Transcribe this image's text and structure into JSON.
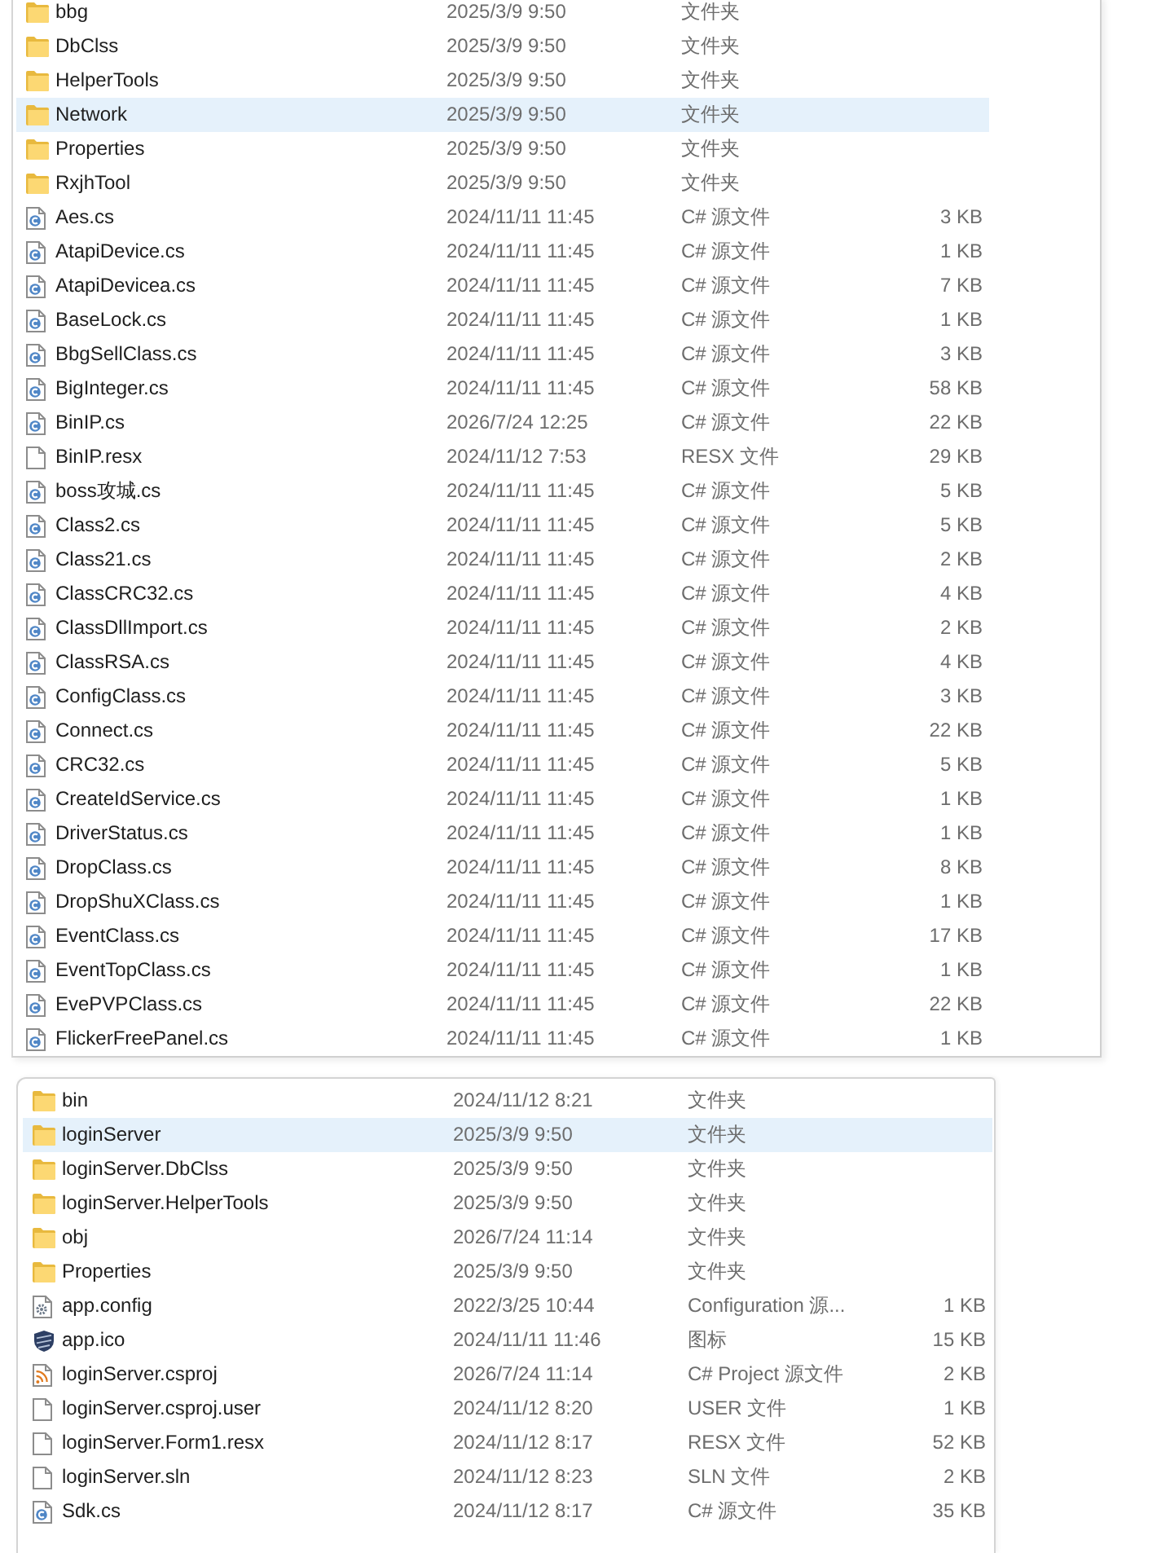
{
  "panels": [
    {
      "rows": [
        {
          "kind": "folder",
          "name": "bbg",
          "date": "2025/3/9 9:50",
          "type": "文件夹",
          "selected": false
        },
        {
          "kind": "folder",
          "name": "DbClss",
          "date": "2025/3/9 9:50",
          "type": "文件夹",
          "selected": false
        },
        {
          "kind": "folder",
          "name": "HelperTools",
          "date": "2025/3/9 9:50",
          "type": "文件夹",
          "selected": false
        },
        {
          "kind": "folder",
          "name": "Network",
          "date": "2025/3/9 9:50",
          "type": "文件夹",
          "selected": true
        },
        {
          "kind": "folder",
          "name": "Properties",
          "date": "2025/3/9 9:50",
          "type": "文件夹",
          "selected": false
        },
        {
          "kind": "folder",
          "name": "RxjhTool",
          "date": "2025/3/9 9:50",
          "type": "文件夹",
          "selected": false
        },
        {
          "kind": "source",
          "name": "Aes.cs",
          "date": "2024/11/11 11:45",
          "type": "C# 源文件",
          "size": "3 KB",
          "selected": false
        },
        {
          "kind": "source",
          "name": "AtapiDevice.cs",
          "date": "2024/11/11 11:45",
          "type": "C# 源文件",
          "size": "1 KB",
          "selected": false
        },
        {
          "kind": "source",
          "name": "AtapiDevicea.cs",
          "date": "2024/11/11 11:45",
          "type": "C# 源文件",
          "size": "7 KB",
          "selected": false
        },
        {
          "kind": "source",
          "name": "BaseLock.cs",
          "date": "2024/11/11 11:45",
          "type": "C# 源文件",
          "size": "1 KB",
          "selected": false
        },
        {
          "kind": "source",
          "name": "BbgSellClass.cs",
          "date": "2024/11/11 11:45",
          "type": "C# 源文件",
          "size": "3 KB",
          "selected": false
        },
        {
          "kind": "source",
          "name": "BigInteger.cs",
          "date": "2024/11/11 11:45",
          "type": "C# 源文件",
          "size": "58 KB",
          "selected": false
        },
        {
          "kind": "source",
          "name": "BinIP.cs",
          "date": "2026/7/24 12:25",
          "type": "C# 源文件",
          "size": "22 KB",
          "selected": false
        },
        {
          "kind": "document",
          "name": "BinIP.resx",
          "date": "2024/11/12 7:53",
          "type": "RESX 文件",
          "size": "29 KB",
          "selected": false
        },
        {
          "kind": "source",
          "name": "boss攻城.cs",
          "date": "2024/11/11 11:45",
          "type": "C# 源文件",
          "size": "5 KB",
          "selected": false
        },
        {
          "kind": "source",
          "name": "Class2.cs",
          "date": "2024/11/11 11:45",
          "type": "C# 源文件",
          "size": "5 KB",
          "selected": false
        },
        {
          "kind": "source",
          "name": "Class21.cs",
          "date": "2024/11/11 11:45",
          "type": "C# 源文件",
          "size": "2 KB",
          "selected": false
        },
        {
          "kind": "source",
          "name": "ClassCRC32.cs",
          "date": "2024/11/11 11:45",
          "type": "C# 源文件",
          "size": "4 KB",
          "selected": false
        },
        {
          "kind": "source",
          "name": "ClassDllImport.cs",
          "date": "2024/11/11 11:45",
          "type": "C# 源文件",
          "size": "2 KB",
          "selected": false
        },
        {
          "kind": "source",
          "name": "ClassRSA.cs",
          "date": "2024/11/11 11:45",
          "type": "C# 源文件",
          "size": "4 KB",
          "selected": false
        },
        {
          "kind": "source",
          "name": "ConfigClass.cs",
          "date": "2024/11/11 11:45",
          "type": "C# 源文件",
          "size": "3 KB",
          "selected": false
        },
        {
          "kind": "source",
          "name": "Connect.cs",
          "date": "2024/11/11 11:45",
          "type": "C# 源文件",
          "size": "22 KB",
          "selected": false
        },
        {
          "kind": "source",
          "name": "CRC32.cs",
          "date": "2024/11/11 11:45",
          "type": "C# 源文件",
          "size": "5 KB",
          "selected": false
        },
        {
          "kind": "source",
          "name": "CreateIdService.cs",
          "date": "2024/11/11 11:45",
          "type": "C# 源文件",
          "size": "1 KB",
          "selected": false
        },
        {
          "kind": "source",
          "name": "DriverStatus.cs",
          "date": "2024/11/11 11:45",
          "type": "C# 源文件",
          "size": "1 KB",
          "selected": false
        },
        {
          "kind": "source",
          "name": "DropClass.cs",
          "date": "2024/11/11 11:45",
          "type": "C# 源文件",
          "size": "8 KB",
          "selected": false
        },
        {
          "kind": "source",
          "name": "DropShuXClass.cs",
          "date": "2024/11/11 11:45",
          "type": "C# 源文件",
          "size": "1 KB",
          "selected": false
        },
        {
          "kind": "source",
          "name": "EventClass.cs",
          "date": "2024/11/11 11:45",
          "type": "C# 源文件",
          "size": "17 KB",
          "selected": false
        },
        {
          "kind": "source",
          "name": "EventTopClass.cs",
          "date": "2024/11/11 11:45",
          "type": "C# 源文件",
          "size": "1 KB",
          "selected": false
        },
        {
          "kind": "source",
          "name": "EvePVPClass.cs",
          "date": "2024/11/11 11:45",
          "type": "C# 源文件",
          "size": "22 KB",
          "selected": false
        },
        {
          "kind": "source",
          "name": "FlickerFreePanel.cs",
          "date": "2024/11/11 11:45",
          "type": "C# 源文件",
          "size": "1 KB",
          "selected": false
        }
      ]
    },
    {
      "rows": [
        {
          "kind": "folder",
          "name": "bin",
          "date": "2024/11/12 8:21",
          "type": "文件夹",
          "selected": false
        },
        {
          "kind": "folder",
          "name": "loginServer",
          "date": "2025/3/9 9:50",
          "type": "文件夹",
          "selected": true
        },
        {
          "kind": "folder",
          "name": "loginServer.DbClss",
          "date": "2025/3/9 9:50",
          "type": "文件夹",
          "selected": false
        },
        {
          "kind": "folder",
          "name": "loginServer.HelperTools",
          "date": "2025/3/9 9:50",
          "type": "文件夹",
          "selected": false
        },
        {
          "kind": "folder",
          "name": "obj",
          "date": "2026/7/24 11:14",
          "type": "文件夹",
          "selected": false
        },
        {
          "kind": "folder",
          "name": "Properties",
          "date": "2025/3/9 9:50",
          "type": "文件夹",
          "selected": false
        },
        {
          "kind": "config",
          "name": "app.config",
          "date": "2022/3/25 10:44",
          "type": "Configuration 源...",
          "size": "1 KB",
          "selected": false
        },
        {
          "kind": "image",
          "name": "app.ico",
          "date": "2024/11/11 11:46",
          "type": "图标",
          "size": "15 KB",
          "selected": false
        },
        {
          "kind": "project",
          "name": "loginServer.csproj",
          "date": "2026/7/24 11:14",
          "type": "C# Project 源文件",
          "size": "2 KB",
          "selected": false
        },
        {
          "kind": "document",
          "name": "loginServer.csproj.user",
          "date": "2024/11/12 8:20",
          "type": "USER 文件",
          "size": "1 KB",
          "selected": false
        },
        {
          "kind": "document",
          "name": "loginServer.Form1.resx",
          "date": "2024/11/12 8:17",
          "type": "RESX 文件",
          "size": "52 KB",
          "selected": false
        },
        {
          "kind": "document",
          "name": "loginServer.sln",
          "date": "2024/11/12 8:23",
          "type": "SLN 文件",
          "size": "2 KB",
          "selected": false
        },
        {
          "kind": "source",
          "name": "Sdk.cs",
          "date": "2024/11/12 8:17",
          "type": "C# 源文件",
          "size": "35 KB",
          "selected": false
        }
      ]
    }
  ]
}
